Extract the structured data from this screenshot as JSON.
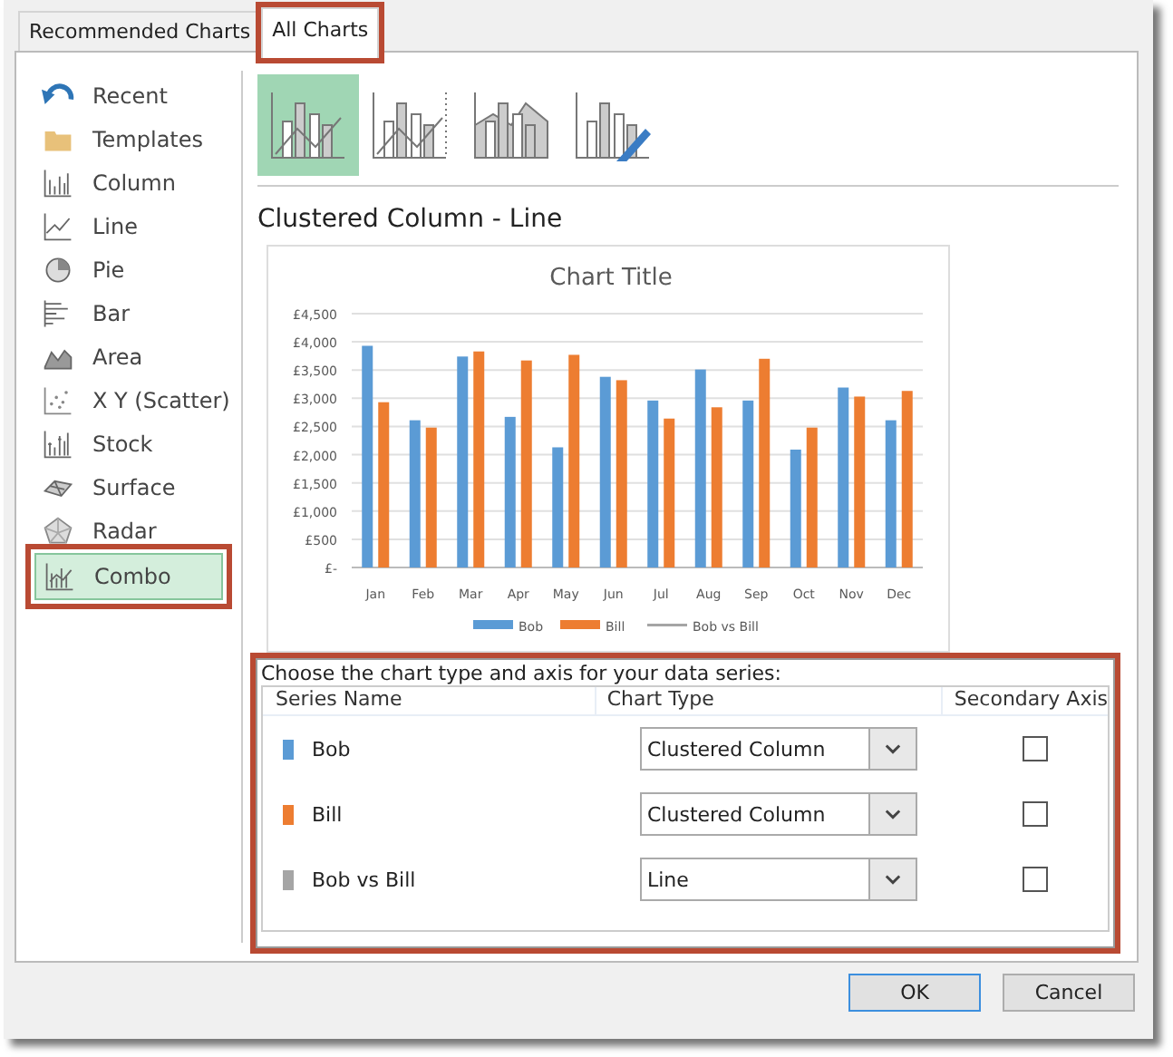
{
  "tabs": [
    {
      "label": "Recommended Charts",
      "selected": false,
      "highlighted": false
    },
    {
      "label": "All Charts",
      "selected": true,
      "highlighted": true
    }
  ],
  "sidebar": {
    "items": [
      {
        "label": "Recent",
        "kind": "recent",
        "selected": false
      },
      {
        "label": "Templates",
        "kind": "templates",
        "selected": false
      },
      {
        "label": "Column",
        "kind": "column",
        "selected": false
      },
      {
        "label": "Line",
        "kind": "line",
        "selected": false
      },
      {
        "label": "Pie",
        "kind": "pie",
        "selected": false
      },
      {
        "label": "Bar",
        "kind": "bar",
        "selected": false
      },
      {
        "label": "Area",
        "kind": "area",
        "selected": false
      },
      {
        "label": "X Y (Scatter)",
        "kind": "scatter",
        "selected": false
      },
      {
        "label": "Stock",
        "kind": "stock",
        "selected": false
      },
      {
        "label": "Surface",
        "kind": "surface",
        "selected": false
      },
      {
        "label": "Radar",
        "kind": "radar",
        "selected": false
      },
      {
        "label": "Combo",
        "kind": "combo",
        "selected": true
      }
    ]
  },
  "subtypes": [
    {
      "kind": "column-line",
      "selected": true
    },
    {
      "kind": "column-line-secondary",
      "selected": false
    },
    {
      "kind": "area-column",
      "selected": false
    },
    {
      "kind": "custom",
      "selected": false
    }
  ],
  "subtype_title": "Clustered Column - Line",
  "preview": {
    "chart_data": {
      "type": "bar",
      "title": "Chart Title",
      "categories": [
        "Jan",
        "Feb",
        "Mar",
        "Apr",
        "May",
        "Jun",
        "Jul",
        "Aug",
        "Sep",
        "Oct",
        "Nov",
        "Dec"
      ],
      "series": [
        {
          "name": "Bob",
          "color": "#5b9bd5",
          "values": [
            3930,
            2610,
            3740,
            2670,
            2130,
            3380,
            2960,
            3510,
            2960,
            2090,
            3190,
            2610
          ]
        },
        {
          "name": "Bill",
          "color": "#ed7d31",
          "values": [
            2930,
            2480,
            3830,
            3670,
            3770,
            3320,
            2640,
            2840,
            3700,
            2480,
            3030,
            3130
          ]
        },
        {
          "name": "Bob vs Bill",
          "color": "#a5a5a5",
          "values": [
            null,
            null,
            null,
            null,
            null,
            null,
            null,
            null,
            null,
            null,
            null,
            null
          ]
        }
      ],
      "ylim": [
        0,
        4500
      ],
      "grid": true,
      "legend": true,
      "yticks": [
        {
          "value": 0,
          "label": "£-"
        },
        {
          "value": 500,
          "label": "£500"
        },
        {
          "value": 1000,
          "label": "£1,000"
        },
        {
          "value": 1500,
          "label": "£1,500"
        },
        {
          "value": 2000,
          "label": "£2,000"
        },
        {
          "value": 2500,
          "label": "£2,500"
        },
        {
          "value": 3000,
          "label": "£3,000"
        },
        {
          "value": 3500,
          "label": "£3,500"
        },
        {
          "value": 4000,
          "label": "£4,000"
        },
        {
          "value": 4500,
          "label": "£4,500"
        }
      ]
    }
  },
  "series_panel": {
    "prompt": "Choose the chart type and axis for your data series:",
    "highlighted": true,
    "columns": [
      "Series Name",
      "Chart Type",
      "Secondary Axis"
    ],
    "rows": [
      {
        "name": "Bob",
        "color": "#5b9bd5",
        "chart_type": "Clustered Column",
        "secondary_axis": false
      },
      {
        "name": "Bill",
        "color": "#ed7d31",
        "chart_type": "Clustered Column",
        "secondary_axis": false
      },
      {
        "name": "Bob vs Bill",
        "color": "#a5a5a5",
        "chart_type": "Line",
        "secondary_axis": false
      }
    ]
  },
  "buttons": [
    {
      "label": "OK",
      "kind": "default"
    },
    {
      "label": "Cancel",
      "kind": "normal"
    }
  ]
}
